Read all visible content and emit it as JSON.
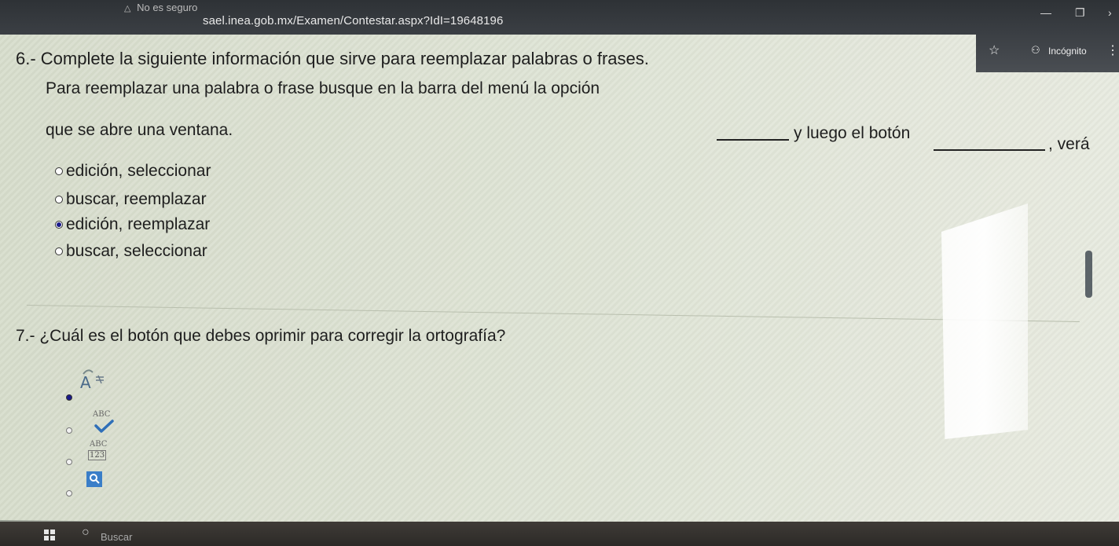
{
  "browser": {
    "security_warning": "No es seguro",
    "url": "sael.inea.gob.mx/Examen/Contestar.aspx?IdI=19648196",
    "incognito_label": "Incógnito"
  },
  "question6": {
    "title": "6.- Complete la siguiente información que sirve para reemplazar palabras o frases.",
    "line1": "Para reemplazar una palabra o frase busque en la barra del menú la opción",
    "line2": "que se abre una ventana.",
    "line3": "y luego el botón",
    "tail": ", verá",
    "options": [
      {
        "label": "edición, seleccionar",
        "selected": false
      },
      {
        "label": "buscar, reemplazar",
        "selected": false
      },
      {
        "label": "edición, reemplazar",
        "selected": true
      },
      {
        "label": "buscar, seleccionar",
        "selected": false
      }
    ]
  },
  "question7": {
    "title": "7.- ¿Cuál es el botón que debes oprimir para corregir la ortografía?",
    "options": [
      {
        "icon": "font-color-icon",
        "selected": true
      },
      {
        "icon": "spelling-check-icon",
        "label": "ABC",
        "selected": false
      },
      {
        "icon": "word-count-icon",
        "label_top": "ABC",
        "label_bottom": "123",
        "selected": false
      },
      {
        "icon": "find-icon",
        "selected": false
      }
    ]
  },
  "taskbar": {
    "search_label": "Buscar"
  }
}
